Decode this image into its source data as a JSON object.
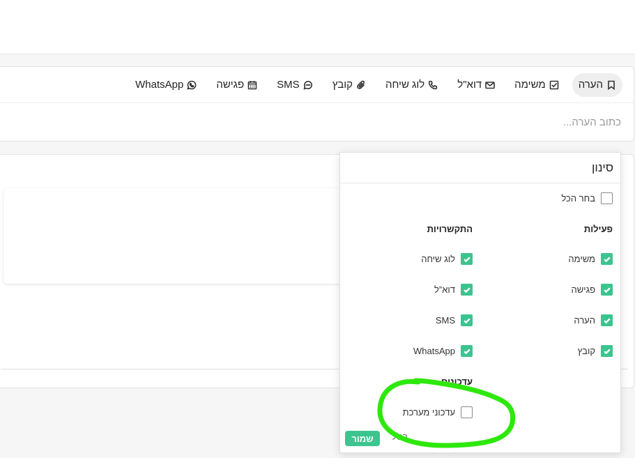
{
  "composer": {
    "tabs": [
      {
        "label": "הערה",
        "icon": "bookmark-icon",
        "active": true
      },
      {
        "label": "משימה",
        "icon": "checkbox-icon"
      },
      {
        "label": "דוא\"ל",
        "icon": "mail-icon"
      },
      {
        "label": "לוג שיחה",
        "icon": "phone-icon"
      },
      {
        "label": "קובץ",
        "icon": "paperclip-icon"
      },
      {
        "label": "SMS",
        "icon": "chat-bubble-icon"
      },
      {
        "label": "פגישה",
        "icon": "calendar-icon"
      },
      {
        "label": "WhatsApp",
        "icon": "whatsapp-icon"
      }
    ],
    "placeholder": "כתוב הערה..."
  },
  "filter": {
    "title": "סינון",
    "select_all": "בחר הכל",
    "activities_title": "פעילות",
    "communications_title": "התקשרויות",
    "updates_title": "עדכונים",
    "activities": [
      {
        "label": "משימה",
        "checked": true
      },
      {
        "label": "פגישה",
        "checked": true
      },
      {
        "label": "הערה",
        "checked": true
      },
      {
        "label": "קובץ",
        "checked": true
      }
    ],
    "communications": [
      {
        "label": "לוג שיחה",
        "checked": true
      },
      {
        "label": "דוא”ל",
        "checked": true
      },
      {
        "label": "SMS",
        "checked": true
      },
      {
        "label": "WhatsApp",
        "checked": true
      }
    ],
    "updates": [
      {
        "label": "עדכוני מערכת",
        "checked": false
      }
    ],
    "cancel_label": "בטל",
    "save_label": "שמור"
  },
  "colors": {
    "accent": "#3cc48f",
    "annotation": "#2ee80c"
  }
}
